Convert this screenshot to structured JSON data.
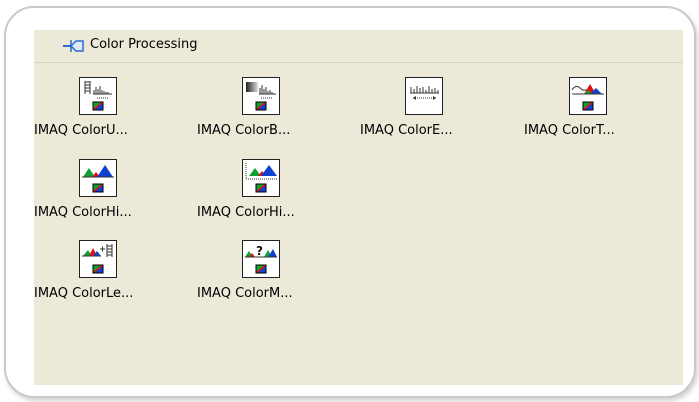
{
  "palette": {
    "title": "Color Processing",
    "pin_icon": "pin-icon",
    "items": [
      {
        "label": "IMAQ ColorU...",
        "icon": "color-user-lookup-icon"
      },
      {
        "label": "IMAQ ColorB...",
        "icon": "color-bcg-icon"
      },
      {
        "label": "IMAQ ColorE...",
        "icon": "color-equalize-icon"
      },
      {
        "label": "IMAQ ColorT...",
        "icon": "color-threshold-icon"
      },
      {
        "label": "IMAQ ColorHi...",
        "icon": "color-histogram-icon"
      },
      {
        "label": "IMAQ ColorHi...",
        "icon": "color-histogram-graph-icon"
      },
      {
        "label": "IMAQ ColorLe...",
        "icon": "color-learn-icon"
      },
      {
        "label": "IMAQ ColorM...",
        "icon": "color-match-icon"
      }
    ]
  },
  "colors": {
    "palette_bg": "#ece9d8",
    "hist_green": "#10a030",
    "hist_blue": "#1040d0",
    "hist_red": "#e01010"
  }
}
